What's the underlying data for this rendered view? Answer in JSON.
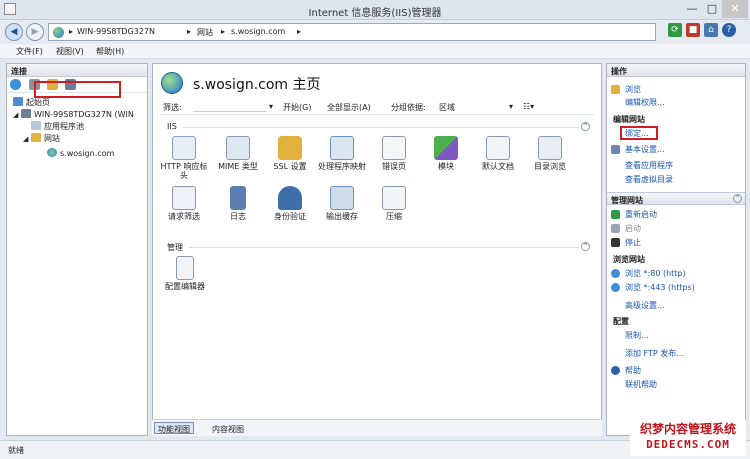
{
  "window": {
    "title": "Internet 信息服务(IIS)管理器"
  },
  "address": {
    "crumbs": [
      "WIN-99S8TDG327N",
      "网站",
      "s.wosign.com"
    ]
  },
  "menu": {
    "file": "文件(F)",
    "view": "视图(V)",
    "help": "帮助(H)"
  },
  "connections": {
    "title": "连接",
    "tree": [
      "起始页",
      "WIN-99S8TDG327N (WIN",
      "应用程序池",
      "网站",
      "s.wosign.com"
    ]
  },
  "center": {
    "title": "s.wosign.com 主页",
    "filter": {
      "label": "筛选:",
      "go": "开始(G)",
      "show_all": "全部显示(A)",
      "group_by": "分组依据:",
      "group_value": "区域"
    },
    "sections": [
      {
        "name": "IIS",
        "items": [
          "HTTP 响应标头",
          "MIME 类型",
          "SSL 设置",
          "处理程序映射",
          "错误页",
          "模块",
          "默认文档",
          "目录浏览",
          "请求筛选",
          "日志",
          "身份验证",
          "输出缓存",
          "压缩"
        ]
      },
      {
        "name": "管理",
        "items": [
          "配置编辑器"
        ]
      }
    ],
    "tabs": [
      "功能视图",
      "内容视图"
    ]
  },
  "actions": {
    "title": "操作",
    "top": [
      "浏览",
      "编辑权限..."
    ],
    "edit_site": {
      "title": "编辑网站",
      "items": [
        "绑定...",
        "基本设置...",
        "查看应用程序",
        "查看虚拟目录"
      ]
    },
    "manage_site": {
      "title": "管理网站",
      "items": [
        "重新启动",
        "启动",
        "停止"
      ],
      "browse_title": "浏览网站",
      "browse_items": [
        "浏览 *:80 (http)",
        "浏览 *:443 (https)"
      ],
      "advanced": "高级设置...",
      "config_title": "配置",
      "config_items": [
        "限制..."
      ]
    },
    "bottom": [
      "添加 FTP 发布...",
      "帮助",
      "联机帮助"
    ]
  },
  "status": {
    "text": "就绪"
  },
  "watermark": {
    "line1": "织梦内容管理系统",
    "line2": "DEDECMS.COM"
  }
}
